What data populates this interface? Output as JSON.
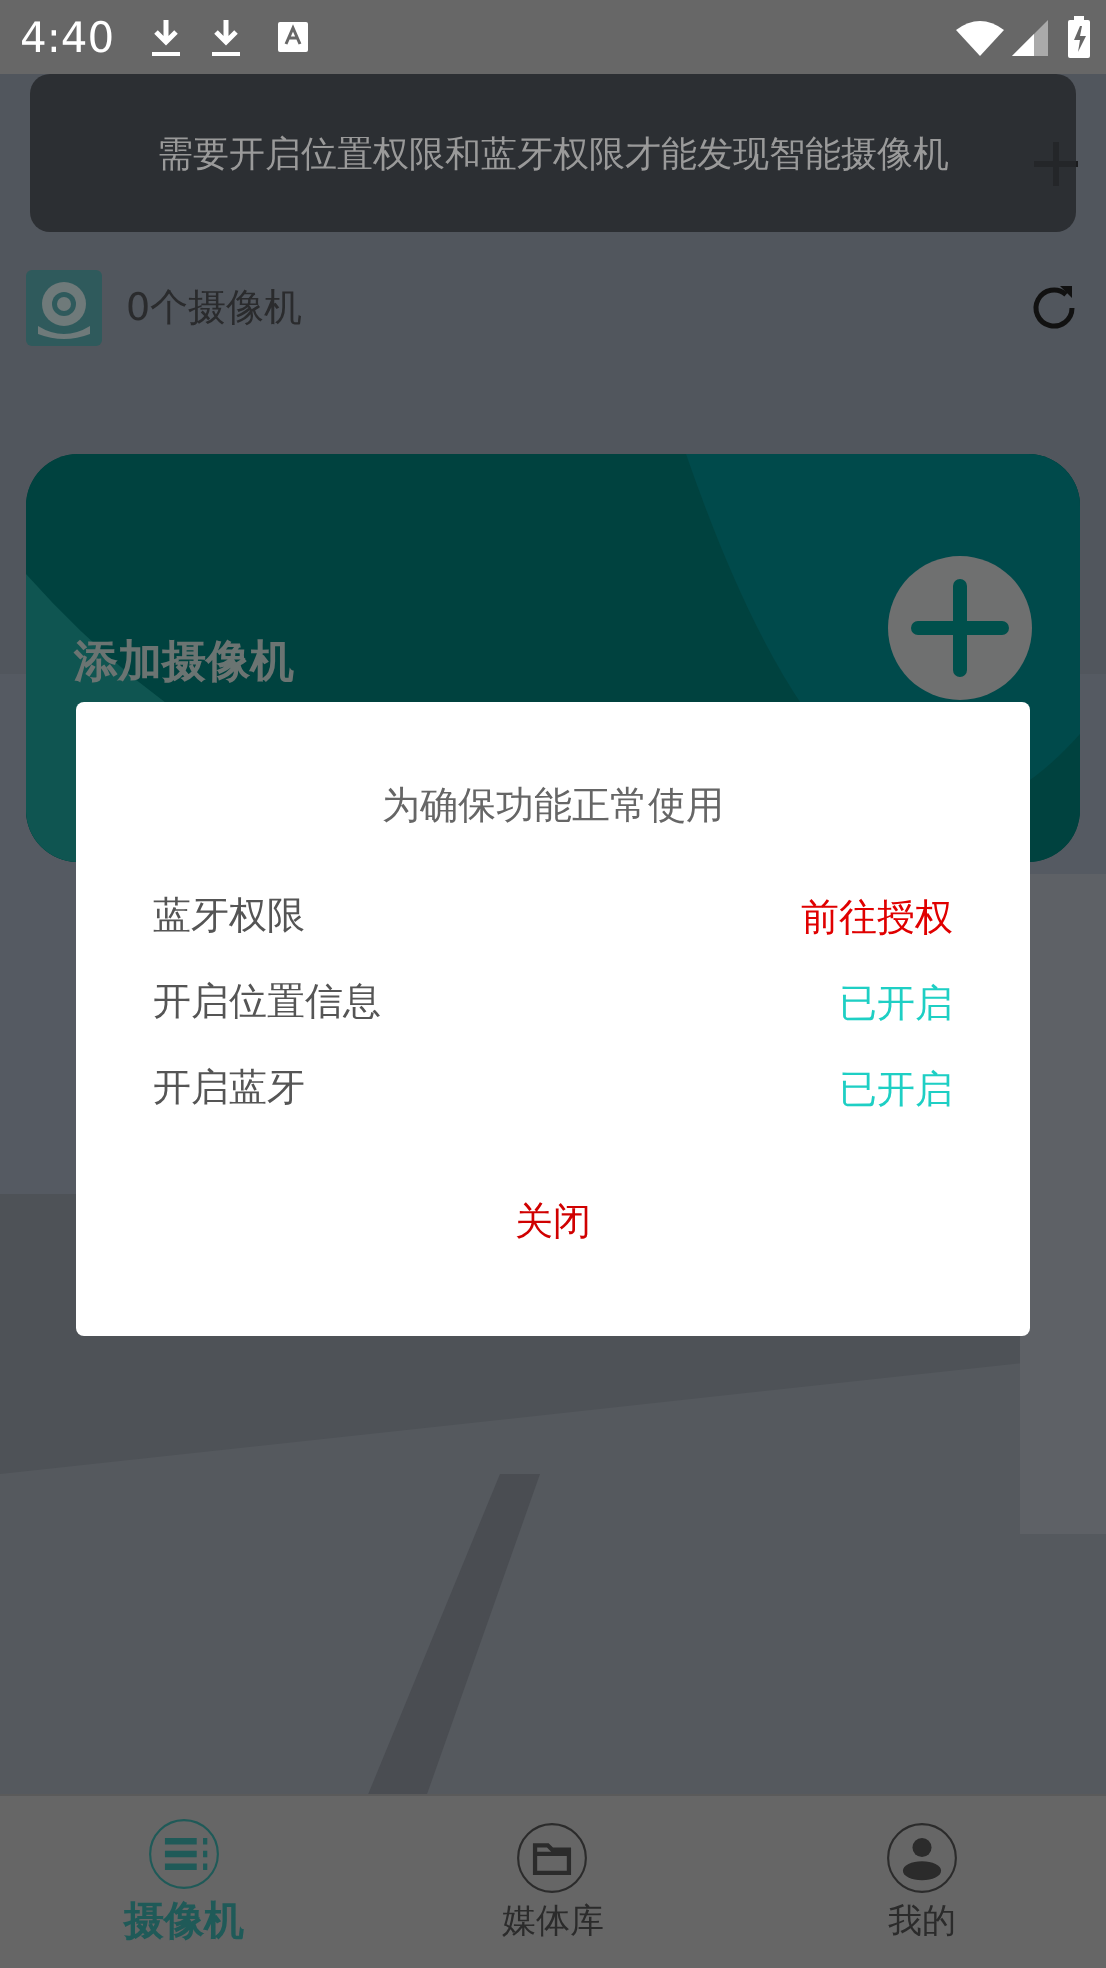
{
  "status_bar": {
    "time": "4:40"
  },
  "camera_count": "0个摄像机",
  "add_card": {
    "label": "添加摄像机"
  },
  "toast": "需要开启位置权限和蓝牙权限才能发现智能摄像机",
  "dialog": {
    "title": "为确保功能正常使用",
    "items": [
      {
        "label": "蓝牙权限",
        "status": "前往授权",
        "granted": false
      },
      {
        "label": "开启位置信息",
        "status": "已开启",
        "granted": true
      },
      {
        "label": "开启蓝牙",
        "status": "已开启",
        "granted": true
      }
    ],
    "close": "关闭"
  },
  "tabs": [
    {
      "kind": "list",
      "label": "摄像机",
      "selected": true
    },
    {
      "kind": "folder",
      "label": "媒体库",
      "selected": false
    },
    {
      "kind": "person",
      "label": "我的",
      "selected": false
    }
  ]
}
